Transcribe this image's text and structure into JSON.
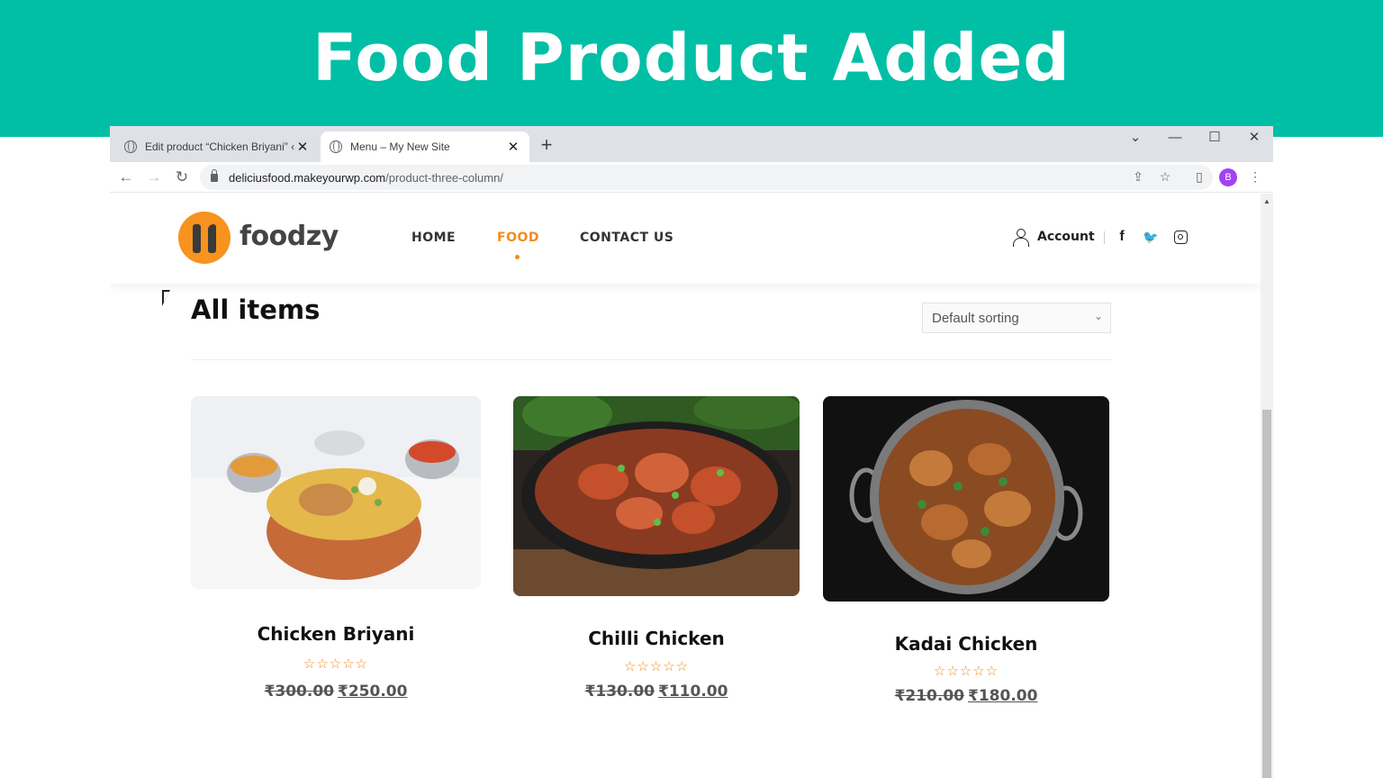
{
  "banner": {
    "title": "Food Product Added"
  },
  "browser": {
    "tabs": [
      {
        "label": "Edit product “Chicken Briyani” ‹ N",
        "close": "✕"
      },
      {
        "label": "Menu – My New Site",
        "close": "✕"
      }
    ],
    "new_tab": "+",
    "window_controls": {
      "chevron": "⌄",
      "minimize": "—",
      "maximize": "☐",
      "close": "✕"
    },
    "nav": {
      "back": "←",
      "forward": "→",
      "reload": "↻"
    },
    "url_host": "deliciusfood.makeyourwp.com",
    "url_path": "/product-three-column/",
    "profile_initial": "B",
    "icons": {
      "share": "⇪",
      "bookmark": "☆",
      "side_panel": "▯",
      "menu": "⋮"
    }
  },
  "site": {
    "logo_text": "foodzy",
    "menu": [
      "HOME",
      "FOOD",
      "CONTACT US"
    ],
    "active_menu": "FOOD",
    "account_label": "Account",
    "social": {
      "facebook": "f",
      "twitter": "🐦"
    }
  },
  "shop": {
    "title": "All items",
    "sort_label": "Default sorting",
    "sort_chevron": "⌄",
    "products": [
      {
        "name": "Chicken Briyani",
        "stars": "☆☆☆☆☆",
        "old_price": "₹300.00",
        "new_price": "₹250.00"
      },
      {
        "name": "Chilli Chicken",
        "stars": "☆☆☆☆☆",
        "old_price": "₹130.00",
        "new_price": "₹110.00"
      },
      {
        "name": "Kadai Chicken",
        "stars": "☆☆☆☆☆",
        "old_price": "₹210.00",
        "new_price": "₹180.00"
      }
    ]
  },
  "colors": {
    "banner": "#00bfa5",
    "accent": "#f28c1a",
    "logo": "#f7931e"
  }
}
